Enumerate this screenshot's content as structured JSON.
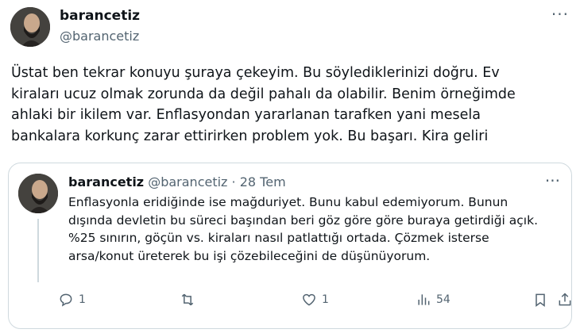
{
  "main_tweet": {
    "name": "barancetiz",
    "handle": "@barancetiz",
    "more": "···",
    "text_lines": [
      "Üstat ben tekrar konuyu şuraya çekeyim. Bu söylediklerinizi doğru. Ev",
      "kiraları ucuz olmak zorunda da değil pahalı da olabilir. Benim örneğimde",
      "ahlaki bir ikilem var. Enflasyondan yararlanan tarafken yani mesela",
      "bankalara korkunç zarar ettirirken problem yok. Bu başarı. Kira geliri"
    ]
  },
  "reply_tweet": {
    "name": "barancetiz",
    "handle": "@barancetiz",
    "separator": "·",
    "date": "28 Tem",
    "more": "···",
    "text_lines": [
      "Enflasyonla eridiğinde ise mağduriyet. Bunu kabul edemiyorum. Bunun",
      "dışında devletin bu süreci başından beri göz göre göre buraya getirdiği açık.",
      "%25 sınırın, göçün vs. kiraları nasıl patlattığı ortada. Çözmek isterse",
      "arsa/konut üreterek bu işi çözebileceğini de düşünüyorum."
    ],
    "actions": {
      "reply_count": "1",
      "retweet_count": "",
      "like_count": "1",
      "views_count": "54"
    }
  },
  "icons": {
    "reply": "reply-icon",
    "retweet": "retweet-icon",
    "like": "like-icon",
    "views": "views-icon",
    "bookmark": "bookmark-icon",
    "share": "share-icon"
  },
  "colors": {
    "text": "#0f1419",
    "secondary": "#536471",
    "border": "#cfd9de"
  }
}
